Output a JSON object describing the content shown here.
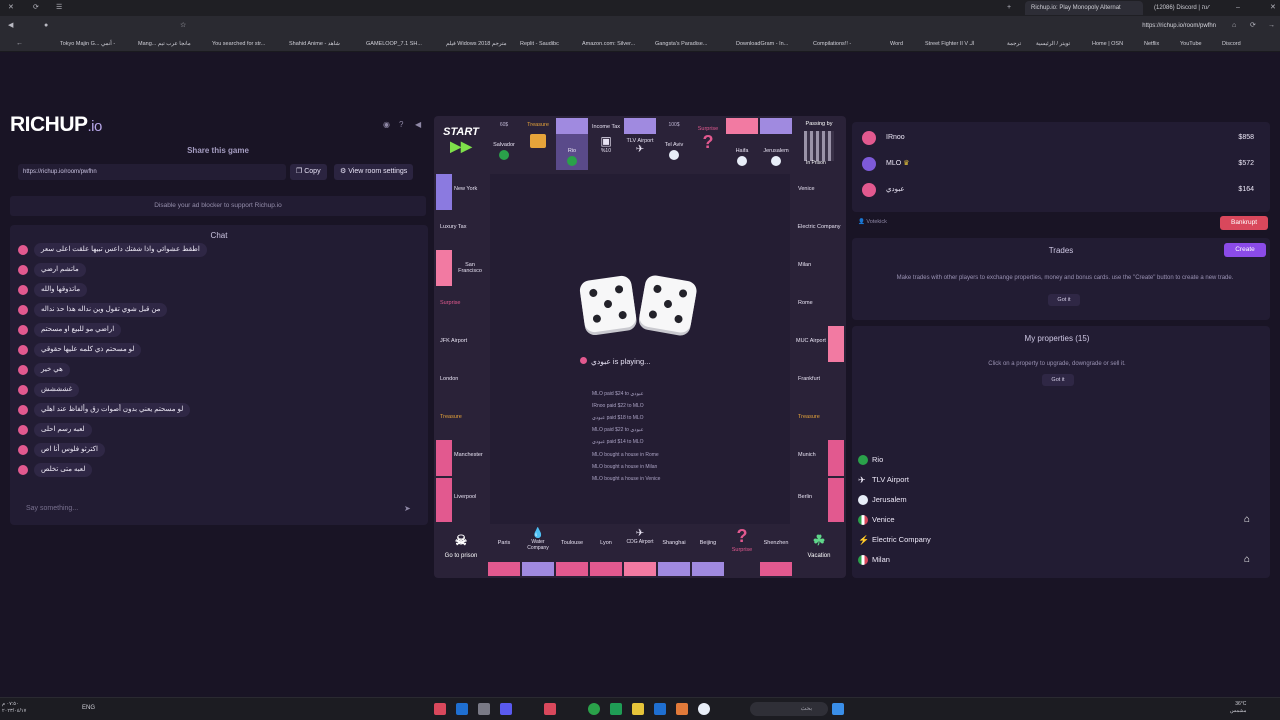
{
  "browser": {
    "tabs": [
      {
        "label": "Richup.io: Play Monopoly Alternat"
      },
      {
        "label": "(12086) Discord | הודעה"
      }
    ],
    "url": "https://richup.io/room/pwfhn",
    "bookmarks": [
      "Tokyo Majin G... أنمي -",
      "Mang... مانجا عرب تيم",
      "You searched for str...",
      "Shahid Anime - شاهد",
      "GAMELOOP_7.1 SH...",
      "فيلم Widows 2018 مترجم",
      "Replit - Saudibc",
      "Amazon.com: Silver...",
      "Gangsta's Paradise...",
      "DownloadGram - In...",
      "Compilations!! -",
      "Word",
      "Street Fighter II V الـ",
      "ترجمة",
      "تويتر / الرئيسية",
      "Home | OSN",
      "Netflix",
      "YouTube",
      "Discord"
    ]
  },
  "app": {
    "logo_main": "RICHUP",
    "logo_suffix": ".io",
    "share_title": "Share this game",
    "share_url": "https://richup.io/room/pwfhn",
    "copy_label": "Copy",
    "room_settings_label": "View room settings",
    "ad_note": "Disable your ad blocker to support Richup.io",
    "chat_title": "Chat",
    "chat_placeholder": "Say something...",
    "chat_messages": [
      "اطقط عشوائي واذا شفتك داعس تبيها علقت اعلى سعر",
      "ماتشم ارضي",
      "ماتذوقها والله",
      "من قبل شوي تقول وين نداله هذا حذ نداله",
      "اراضي مو للبيع او مسحتم",
      "لو مسحتم ذي كلمه عليها حقوقي",
      "هي خير",
      "غشششش",
      "لو مسحتم يعني بدون أصوات زق وألفاظ عند اهلي",
      "لعبه رسم احلى",
      "اكترثو فلوس أنا اص",
      "لعبه متى تخلص"
    ]
  },
  "board": {
    "start_label": "START",
    "go_to_prison_label": "Go to prison",
    "vacation_label": "Vacation",
    "passing_label": "Passing by",
    "in_prison_label": "In Prison",
    "top_tiles": [
      "Salvador",
      "Treasure",
      "Rio",
      "Income Tax",
      "TLV Airport",
      "Tel Aviv",
      "Surprise",
      "Haifa",
      "Jerusalem"
    ],
    "top_prices": [
      "60$",
      "",
      "",
      "%10",
      "",
      "100$",
      "",
      "",
      ""
    ],
    "left_tiles": [
      "New York",
      "Luxury Tax",
      "San Francisco",
      "Surprise",
      "JFK Airport",
      "London",
      "Treasure",
      "Manchester",
      "Liverpool"
    ],
    "right_tiles": [
      "Venice",
      "Electric Company",
      "Milan",
      "Rome",
      "MUC Airport",
      "Frankfurt",
      "Treasure",
      "Munich",
      "Berlin"
    ],
    "bottom_tiles": [
      "Paris",
      "Water Company",
      "Toulouse",
      "Lyon",
      "CDG Airport",
      "Shanghai",
      "Beijing",
      "Surprise",
      "Shenzhen"
    ],
    "dice": [
      5,
      5
    ],
    "playing_text": "عبودي is playing...",
    "log": [
      "MLO paid $24 to عبودي",
      "IRnoo paid $22 to MLO",
      "عبودي paid $18 to MLO",
      "MLO paid $22 to عبودي",
      "عبودي paid $14 to MLO",
      "MLO bought a house in Rome",
      "MLO bought a house in Milan",
      "MLO bought a house in Venice"
    ]
  },
  "players": [
    {
      "name": "IRnoo",
      "money": "$858",
      "color": "#e2598f"
    },
    {
      "name": "MLO",
      "money": "$572",
      "color": "#7d5ad8"
    },
    {
      "name": "عبودي",
      "money": "$164",
      "color": "#e2598f"
    }
  ],
  "votekick_label": "Votekick",
  "bankrupt_label": "Bankrupt",
  "trades": {
    "title": "Trades",
    "create_label": "Create",
    "info": "Make trades with other players to exchange properties, money and bonus cards. use the \"Create\" button to create a new trade.",
    "got_it": "Got it"
  },
  "properties": {
    "title": "My properties (15)",
    "info": "Click on a property to upgrade, downgrade or sell it.",
    "got_it": "Got it",
    "items": [
      {
        "name": "Rio",
        "icon": "flag-brazil-icon",
        "house": false
      },
      {
        "name": "TLV Airport",
        "icon": "airplane-icon",
        "house": false
      },
      {
        "name": "Jerusalem",
        "icon": "flag-israel-icon",
        "house": false
      },
      {
        "name": "Venice",
        "icon": "flag-italy-icon",
        "house": true
      },
      {
        "name": "Electric Company",
        "icon": "lightning-icon",
        "house": false
      },
      {
        "name": "Milan",
        "icon": "flag-italy-icon",
        "house": true
      }
    ]
  },
  "taskbar": {
    "time": "٠٧:٥٠ م",
    "date": "٢٠٢٣/٠٤/١٧",
    "lang": "ENG",
    "search": "بحث",
    "weather_temp": "36°C",
    "weather_text": "مشمس"
  },
  "colors": {
    "accent": "#8b4be8",
    "bankrupt": "#d9485c",
    "pink": "#e2598f"
  }
}
